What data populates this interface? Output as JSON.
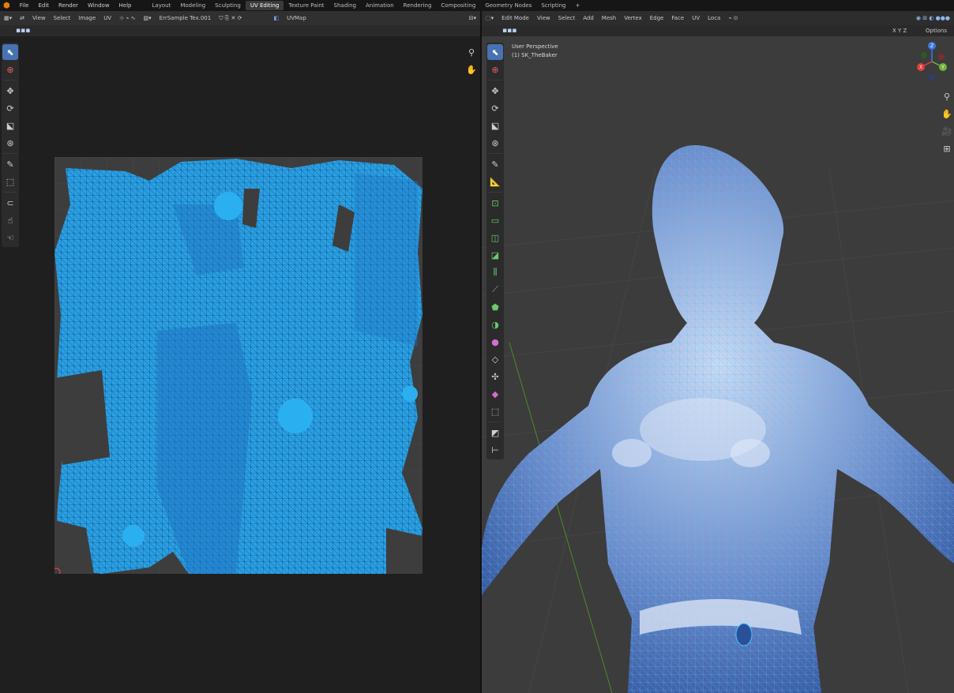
{
  "topbar": {
    "logo": "⬢",
    "menu": [
      "File",
      "Edit",
      "Render",
      "Window",
      "Help"
    ],
    "workspaces": [
      "Layout",
      "Modeling",
      "Sculpting",
      "UV Editing",
      "Texture Paint",
      "Shading",
      "Animation",
      "Rendering",
      "Compositing",
      "Geometry Nodes",
      "Scripting"
    ],
    "active_workspace": "UV Editing",
    "add_tab": "+"
  },
  "uv_editor": {
    "header": {
      "view": "View",
      "select": "Select",
      "image": "Image",
      "uv": "UV",
      "image_name": "ErrSample Tex.001",
      "uv_map": "UVMap"
    }
  },
  "viewport": {
    "header": {
      "mode": "Edit Mode",
      "view": "View",
      "select": "Select",
      "add": "Add",
      "mesh": "Mesh",
      "vertex": "Vertex",
      "edge": "Edge",
      "face": "Face",
      "uv": "UV",
      "transform": "Loca",
      "options": "Options",
      "axes": "X Y Z"
    },
    "info": {
      "perspective": "User Perspective",
      "object": "(1) SK_TheBaker"
    },
    "gizmo": {
      "x": "X",
      "y": "Y",
      "z": "Z"
    }
  },
  "colors": {
    "uv_mesh": "#2e9fe0",
    "uv_mesh_dark": "#1f74c2",
    "accent": "#4772b3",
    "viewport_bg": "#3c3c3c",
    "gizmo_x": "#e23c3c",
    "gizmo_y": "#6eb53a",
    "gizmo_z": "#3c78e2"
  }
}
